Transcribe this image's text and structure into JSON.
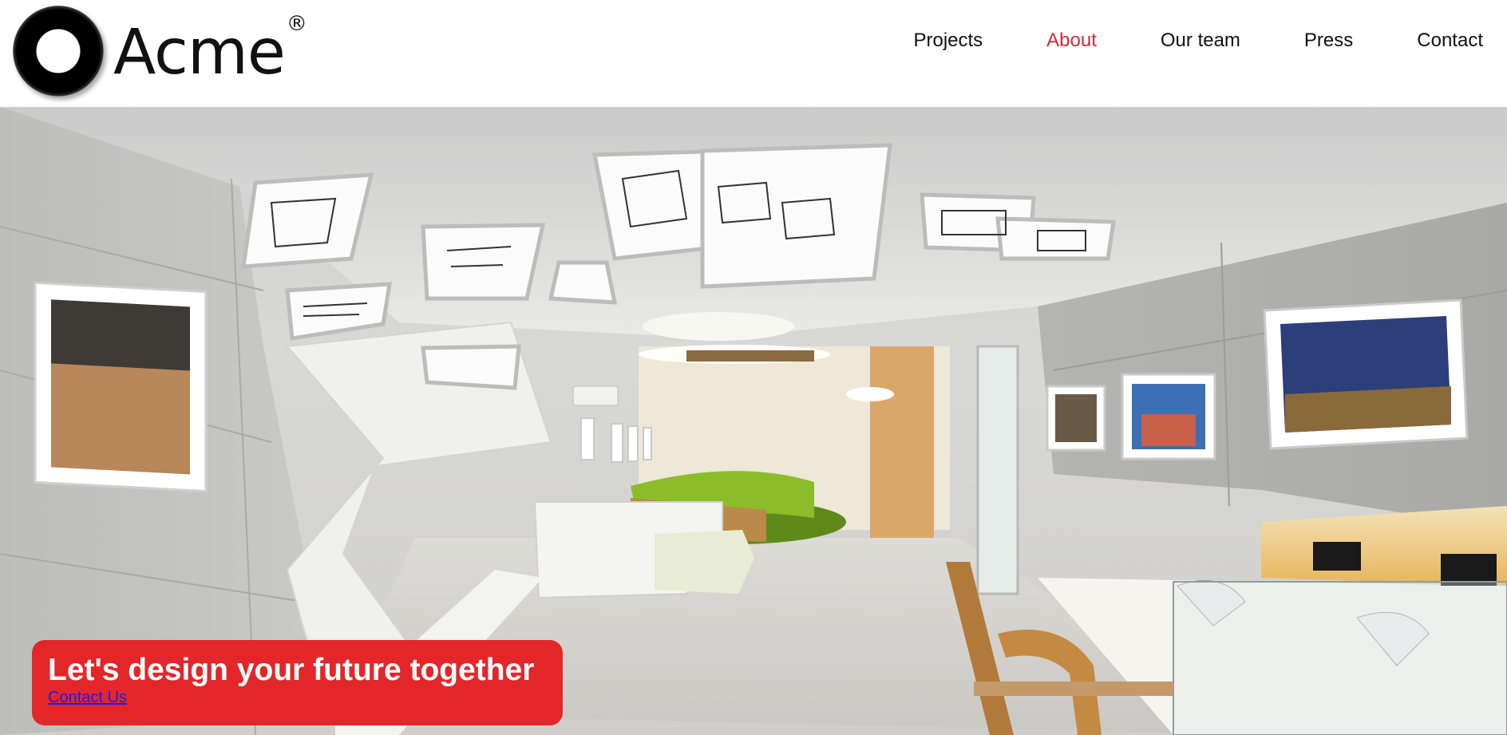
{
  "brand": {
    "name": "Acme",
    "registered_mark": "®"
  },
  "nav": {
    "items": [
      {
        "label": "Projects",
        "active": false
      },
      {
        "label": "About",
        "active": true
      },
      {
        "label": "Our team",
        "active": false
      },
      {
        "label": "Press",
        "active": false
      },
      {
        "label": "Contact",
        "active": false
      }
    ]
  },
  "hero": {
    "image_description_icon": "office-interior-photo",
    "cta_title": "Let's design your future together",
    "cta_link": "Contact Us"
  },
  "colors": {
    "accent": "#e3262a",
    "active_nav": "#d32a2e",
    "link": "#1a1aff"
  }
}
